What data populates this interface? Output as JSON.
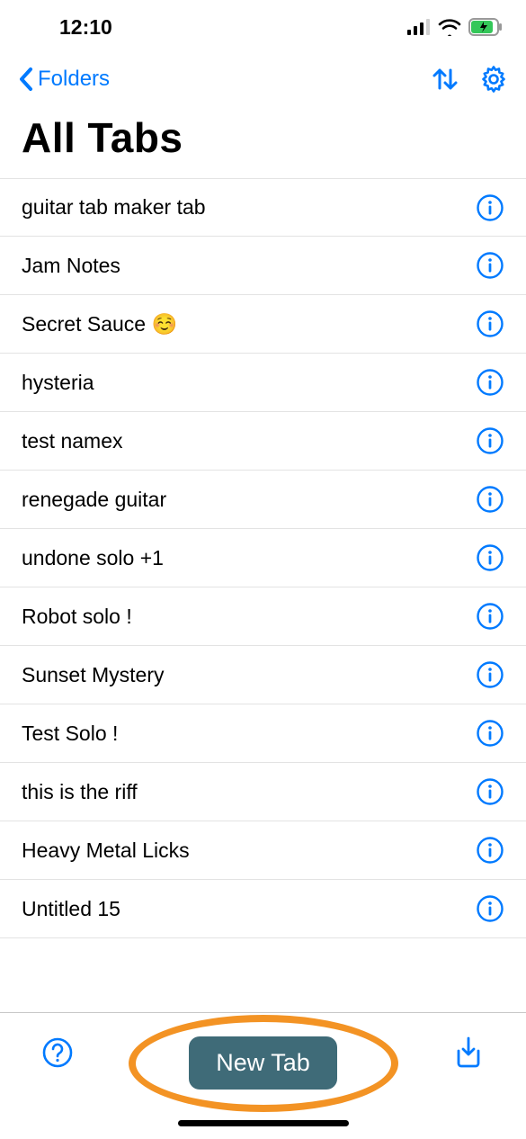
{
  "statusbar": {
    "time": "12:10"
  },
  "nav": {
    "back_label": "Folders"
  },
  "page": {
    "title": "All Tabs"
  },
  "toolbar": {
    "newtab_label": "New Tab"
  },
  "tabs": [
    {
      "title": "guitar tab maker tab"
    },
    {
      "title": "Jam Notes"
    },
    {
      "title": "Secret Sauce ☺️"
    },
    {
      "title": "hysteria"
    },
    {
      "title": "test namex"
    },
    {
      "title": "renegade guitar"
    },
    {
      "title": "undone solo +1"
    },
    {
      "title": "Robot solo !"
    },
    {
      "title": "Sunset Mystery"
    },
    {
      "title": "Test Solo !"
    },
    {
      "title": "this is the riff"
    },
    {
      "title": "Heavy Metal Licks"
    },
    {
      "title": "Untitled 15"
    }
  ]
}
